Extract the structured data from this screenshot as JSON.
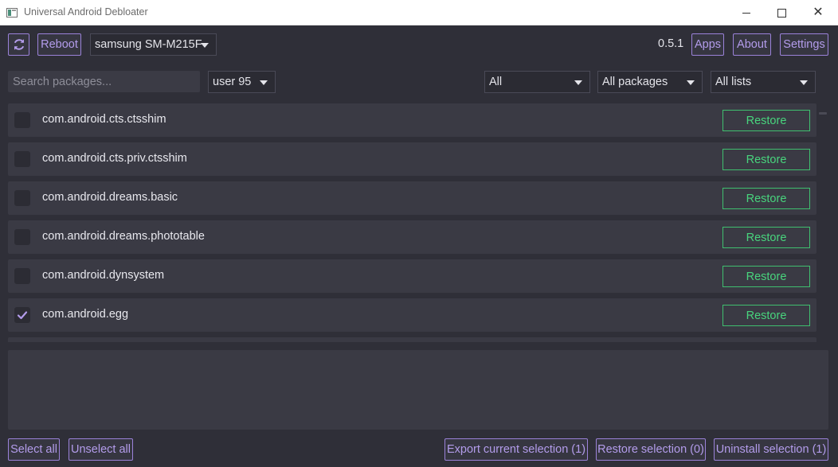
{
  "window": {
    "title": "Universal Android Debloater",
    "close_glyph": "✕"
  },
  "toolbar": {
    "reboot_label": "Reboot",
    "device": "samsung SM-M215F",
    "version": "0.5.1",
    "apps_label": "Apps",
    "about_label": "About",
    "settings_label": "Settings"
  },
  "filters": {
    "search_placeholder": "Search packages...",
    "user": "user 95",
    "state": "All",
    "removal": "All packages",
    "list": "All lists"
  },
  "packages": [
    {
      "name": "com.android.cts.ctsshim",
      "selected": false,
      "action": "Restore"
    },
    {
      "name": "com.android.cts.priv.ctsshim",
      "selected": false,
      "action": "Restore"
    },
    {
      "name": "com.android.dreams.basic",
      "selected": false,
      "action": "Restore"
    },
    {
      "name": "com.android.dreams.phototable",
      "selected": false,
      "action": "Restore"
    },
    {
      "name": "com.android.dynsystem",
      "selected": false,
      "action": "Restore"
    },
    {
      "name": "com.android.egg",
      "selected": true,
      "action": "Restore"
    }
  ],
  "footer": {
    "select_all": "Select all",
    "unselect_all": "Unselect all",
    "export": "Export current selection (1)",
    "restore": "Restore selection (0)",
    "uninstall": "Uninstall selection (1)"
  },
  "colors": {
    "background": "#2f2f38",
    "accent": "#b39ceb",
    "restore_green": "#48d47d",
    "row": "#3a3a44"
  },
  "icons": {
    "refresh": "refresh-icon",
    "checkmark": "checkmark-icon",
    "caret": "chevron-down-icon"
  }
}
